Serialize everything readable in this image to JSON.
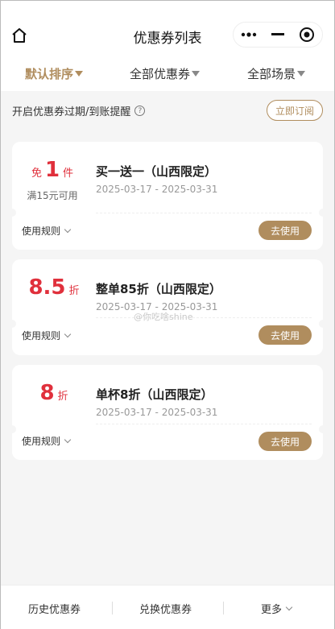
{
  "nav": {
    "title": "优惠券列表",
    "home_icon": "home-icon",
    "more_icon": "more-dots-icon",
    "minimize_icon": "minimize-icon",
    "close_icon": "target-close-icon"
  },
  "filters": [
    {
      "label": "默认排序",
      "active": true
    },
    {
      "label": "全部优惠券",
      "active": false
    },
    {
      "label": "全部场景",
      "active": false
    }
  ],
  "remind": {
    "text": "开启优惠券过期/到账提醒",
    "help": "?",
    "button": "立即订阅"
  },
  "coupons": [
    {
      "prefix": "免",
      "value": "1",
      "suffix": "件",
      "condition": "满15元可用",
      "title": "买一送一（山西限定）",
      "date": "2025-03-17 - 2025-03-31",
      "rules": "使用规则",
      "action": "去使用"
    },
    {
      "prefix": "",
      "value": "8.5",
      "suffix": "折",
      "condition": "",
      "title": "整单85折（山西限定）",
      "date": "2025-03-17 - 2025-03-31",
      "rules": "使用规则",
      "action": "去使用"
    },
    {
      "prefix": "",
      "value": "8",
      "suffix": "折",
      "condition": "",
      "title": "单杯8折（山西限定）",
      "date": "2025-03-17 - 2025-03-31",
      "rules": "使用规则",
      "action": "去使用"
    }
  ],
  "watermark": "@你吃啥shine",
  "bottom": [
    {
      "label": "历史优惠券"
    },
    {
      "label": "兑换优惠券"
    },
    {
      "label": "更多"
    }
  ],
  "colors": {
    "accent": "#b08d5e",
    "price": "#e0303c"
  }
}
